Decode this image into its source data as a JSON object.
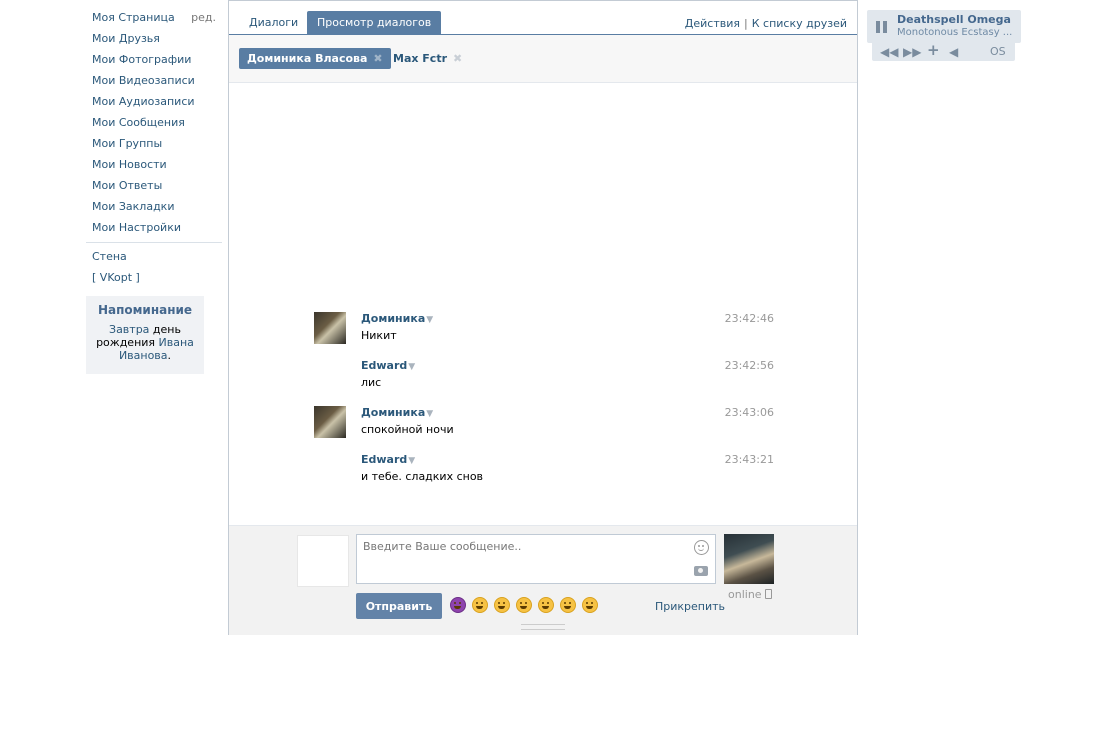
{
  "left_nav": {
    "items": [
      {
        "label": "Моя Страница",
        "extra": "ред."
      },
      {
        "label": "Мои Друзья"
      },
      {
        "label": "Мои Фотографии"
      },
      {
        "label": "Мои Видеозаписи"
      },
      {
        "label": "Мои Аудиозаписи"
      },
      {
        "label": "Мои Сообщения"
      },
      {
        "label": "Мои Группы"
      },
      {
        "label": "Мои Новости"
      },
      {
        "label": "Мои Ответы"
      },
      {
        "label": "Мои Закладки"
      },
      {
        "label": "Мои Настройки"
      }
    ],
    "extra_items": [
      {
        "label": "Стена"
      },
      {
        "label": "[ VKopt ]"
      }
    ]
  },
  "reminder": {
    "title": "Напоминание",
    "link1": "Завтра",
    "text1": " день рождения ",
    "link2": "Ивана Иванова",
    "text2": "."
  },
  "tabs": {
    "dialogs": "Диалоги",
    "view": "Просмотр диалогов",
    "actions": "Действия",
    "separator": "|",
    "friends": "К списку друзей"
  },
  "peers": [
    {
      "name": "Доминика Власова",
      "active": true
    },
    {
      "name": "Max Fctr",
      "active": false
    }
  ],
  "messages": [
    {
      "author": "Доминика",
      "text": "Никит",
      "time": "23:42:46",
      "avatar": true
    },
    {
      "author": "Edward",
      "text": "лис",
      "time": "23:42:56",
      "avatar": false
    },
    {
      "author": "Доминика",
      "text": "спокойной ночи",
      "time": "23:43:06",
      "avatar": true
    },
    {
      "author": "Edward",
      "text": "и тебе. сладких снов",
      "time": "23:43:21",
      "avatar": false
    }
  ],
  "composer": {
    "placeholder": "Введите Ваше сообщение..",
    "send_label": "Отправить",
    "attach_label": "Прикрепить",
    "online_label": "online"
  },
  "player": {
    "artist": "Deathspell Omega",
    "title": "Monotonous Ecstasy ...",
    "os_label": "OS"
  },
  "colors": {
    "accent": "#597da3",
    "link": "#2b587a",
    "send_button": "#6383a8"
  }
}
